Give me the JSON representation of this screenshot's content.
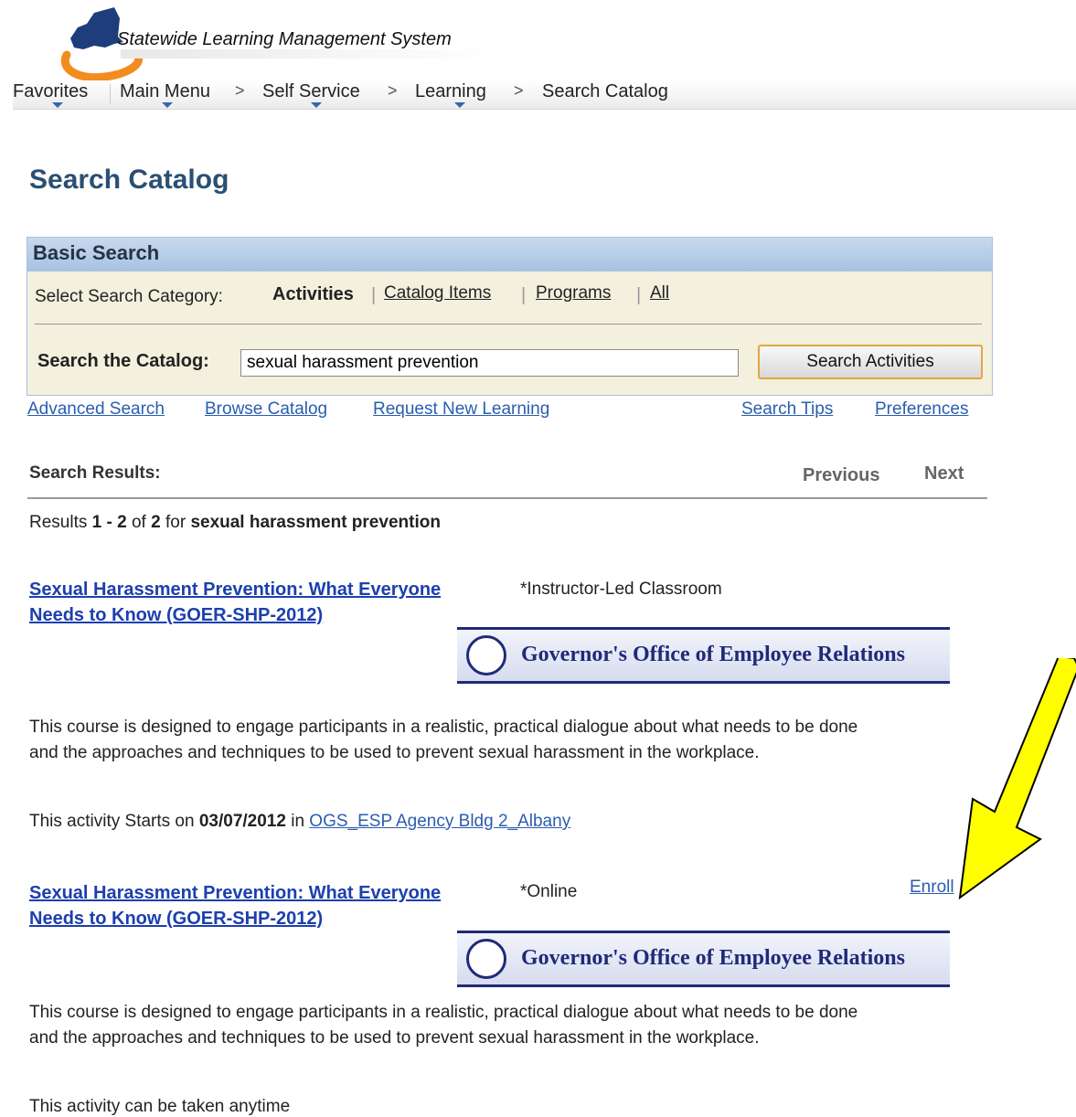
{
  "header": {
    "app_title": "Statewide Learning Management System"
  },
  "nav": {
    "favorites": "Favorites",
    "main_menu": "Main Menu",
    "self_service": "Self Service",
    "learning": "Learning",
    "search_catalog": "Search Catalog",
    "separator": ">"
  },
  "page_title": "Search Catalog",
  "basic_search": {
    "title": "Basic Search",
    "category_label": "Select Search Category:",
    "categories": [
      "Activities",
      "Catalog Items",
      "Programs",
      "All"
    ],
    "active_category": "Activities",
    "catalog_label": "Search the Catalog:",
    "search_value": "sexual harassment prevention",
    "search_button": "Search Activities"
  },
  "links": {
    "advanced_search": "Advanced Search",
    "browse_catalog": "Browse Catalog",
    "request_new_learning": "Request New Learning",
    "search_tips": "Search Tips",
    "preferences": "Preferences"
  },
  "results": {
    "label": "Search Results:",
    "previous": "Previous",
    "next": "Next",
    "summary_prefix": "Results",
    "summary_start": "1",
    "summary_dash": "-",
    "summary_end": "2",
    "summary_of": "of",
    "summary_total": "2",
    "summary_for": "for",
    "summary_query": "sexual harassment prevention"
  },
  "courses": [
    {
      "title_line1": "Sexual Harassment Prevention: What Everyone",
      "title_line2": "Needs to Know (GOER-SHP-2012)",
      "type": "*Instructor-Led Classroom",
      "banner": "Governor's Office of Employee Relations",
      "description_line1": "This course is designed to engage participants in a realistic, practical dialogue about what needs to be done",
      "description_line2": "and the approaches and techniques to be used to prevent sexual harassment in the workplace.",
      "start_prefix": "This activity Starts on",
      "start_date": "03/07/2012",
      "start_in": "in",
      "location": "OGS_ESP Agency Bldg 2_Albany"
    },
    {
      "title_line1": "Sexual Harassment Prevention: What Everyone",
      "title_line2": "Needs to Know (GOER-SHP-2012)",
      "type": "*Online",
      "enroll": "Enroll",
      "banner": "Governor's Office of Employee Relations",
      "description_line1": "This course is designed to engage participants in a realistic, practical dialogue about what needs to be done",
      "description_line2": "and the approaches and techniques to be used to prevent sexual harassment in the workplace.",
      "availability": "This activity can be taken anytime"
    }
  ],
  "colors": {
    "page_title": "#2b4f73",
    "link": "#2a5db0",
    "course_title": "#1c3fae",
    "annotation_arrow": "#ffff00"
  }
}
